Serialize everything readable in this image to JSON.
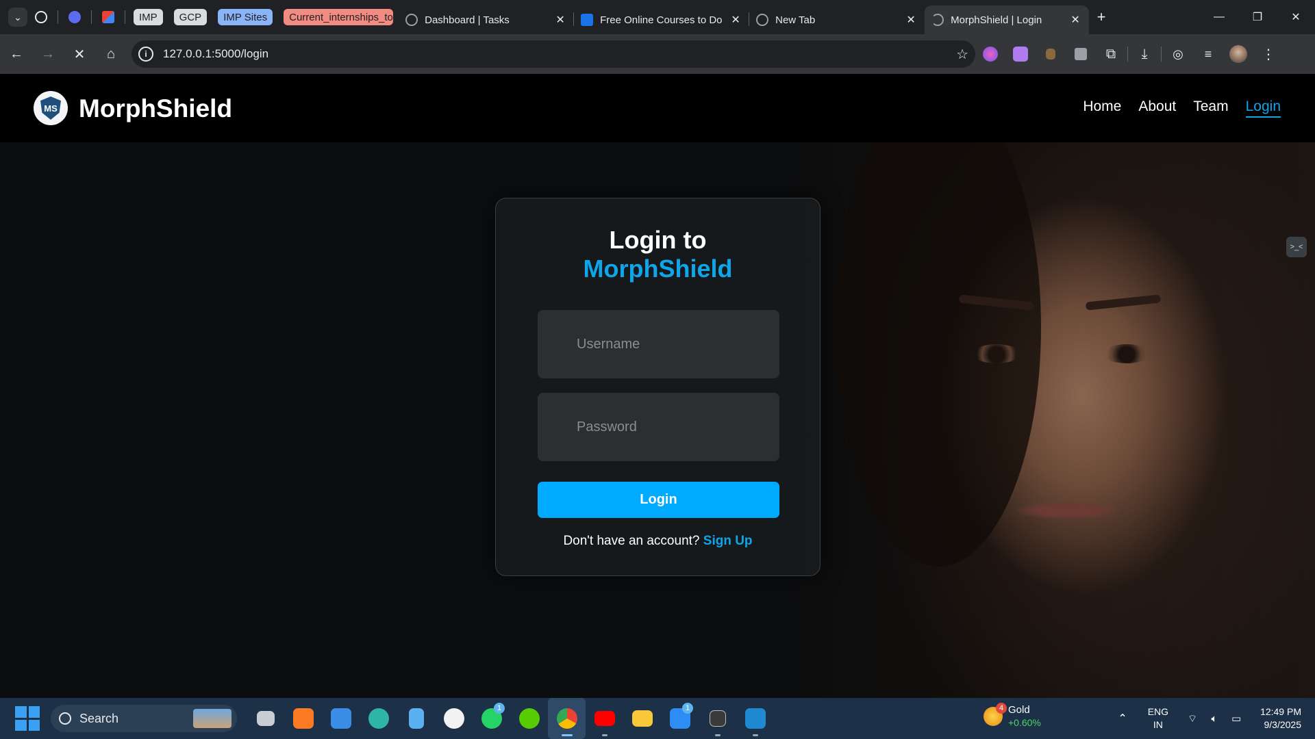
{
  "browser": {
    "pinned_groups": [
      {
        "label": "IMP",
        "color": "#dadce0"
      },
      {
        "label": "GCP",
        "color": "#dadce0"
      },
      {
        "label": "IMP Sites",
        "color": "#8ab4f8"
      },
      {
        "label": "Current_internships_to",
        "color": "#f28b82"
      }
    ],
    "tabs": [
      {
        "title": "Dashboard | Tasks",
        "close": "✕"
      },
      {
        "title": "Free Online Courses to Do",
        "close": "✕"
      },
      {
        "title": "New Tab",
        "close": "✕"
      },
      {
        "title": "MorphShield | Login",
        "close": "✕",
        "active": true
      }
    ],
    "new_tab": "+",
    "address": "127.0.0.1:5000/login",
    "window_controls": [
      "—",
      "❐",
      "✕"
    ]
  },
  "site": {
    "brand": "MorphShield",
    "logo_text": "MS",
    "nav": [
      {
        "label": "Home"
      },
      {
        "label": "About"
      },
      {
        "label": "Team"
      },
      {
        "label": "Login",
        "active": true
      }
    ],
    "side_extension_glyph": ">_<"
  },
  "login": {
    "title_line1": "Login to",
    "title_line2": "MorphShield",
    "username_placeholder": "Username",
    "password_placeholder": "Password",
    "button_label": "Login",
    "signup_prompt": "Don't have an account?",
    "signup_link": "Sign Up",
    "accent_color": "#0ea5e9"
  },
  "taskbar": {
    "search_label": "Search",
    "apps": [
      {
        "name": "task-view",
        "color": "#c9ced4"
      },
      {
        "name": "xampp",
        "color": "#fb7a24"
      },
      {
        "name": "microsoft-store",
        "color": "#3a8ee6"
      },
      {
        "name": "edge",
        "color": "#2fb5a6"
      },
      {
        "name": "notepad",
        "color": "#5ab0f0"
      },
      {
        "name": "uplay",
        "color": "#f2f2f2"
      },
      {
        "name": "whatsapp",
        "color": "#25d366",
        "badge": "1"
      },
      {
        "name": "duolingo",
        "color": "#58cc02"
      },
      {
        "name": "chrome",
        "color": "#4285f4",
        "active": true
      },
      {
        "name": "youtube",
        "color": "#ff0000"
      },
      {
        "name": "file-explorer",
        "color": "#f8c73a"
      },
      {
        "name": "todo",
        "color": "#2e8df5",
        "badge": "1"
      },
      {
        "name": "medium",
        "color": "#e8e8e8"
      },
      {
        "name": "vscode",
        "color": "#1f8ad2"
      }
    ],
    "widget": {
      "name": "Gold",
      "value": "+0.60%",
      "badge": "4"
    },
    "language": {
      "line1": "ENG",
      "line2": "IN"
    },
    "time": "12:49 PM",
    "date": "9/3/2025"
  }
}
